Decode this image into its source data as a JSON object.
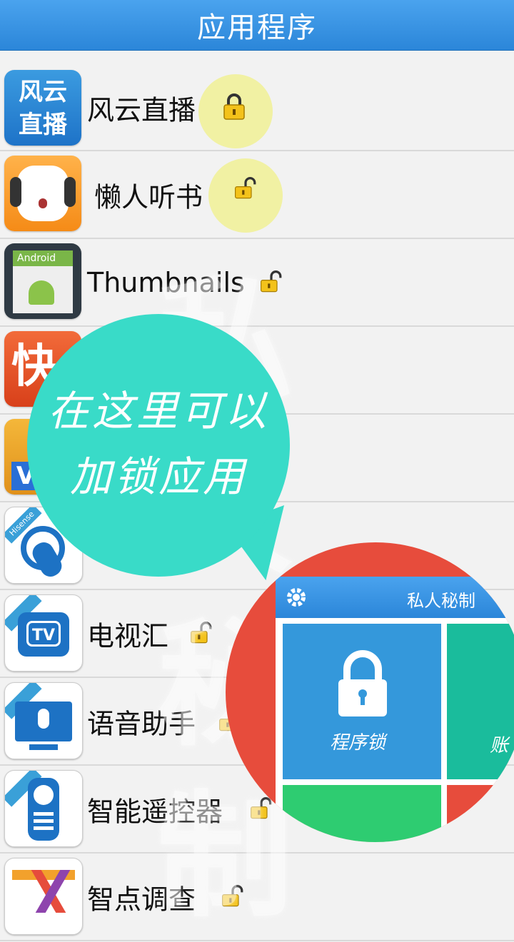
{
  "header": {
    "title": "应用程序"
  },
  "apps": [
    {
      "label": "风云直播",
      "icon_text_top": "风云",
      "icon_text_bottom": "直播",
      "locked": true
    },
    {
      "label": "懒人听书",
      "locked": false
    },
    {
      "label": "Thumbnails",
      "icon_text": "Android",
      "locked": false
    },
    {
      "label": "",
      "icon_text": "快",
      "locked": false
    },
    {
      "label": "",
      "icon_text": "V",
      "locked": false
    },
    {
      "label": "",
      "icon_text": "Hisense",
      "locked": false
    },
    {
      "label": "电视汇",
      "icon_text": "TV",
      "locked": false
    },
    {
      "label": "语音助手",
      "locked": false
    },
    {
      "label": "智能遥控器",
      "locked": false
    },
    {
      "label": "智点调查",
      "locked": false
    }
  ],
  "overlay": {
    "watermark": "私人秘制",
    "bubble_line1": "在这里可以",
    "bubble_line2": "加锁应用",
    "preview_title": "私人秘制",
    "preview_tile1": "程序锁",
    "preview_tile2": "账"
  },
  "colors": {
    "title_bar": "#2b86d9",
    "bubble": "#39dbc8",
    "zoom_circle": "#e74c3c",
    "tile_blue": "#3498db",
    "tile_teal": "#1abc9c",
    "tile_green": "#2ecc71"
  }
}
